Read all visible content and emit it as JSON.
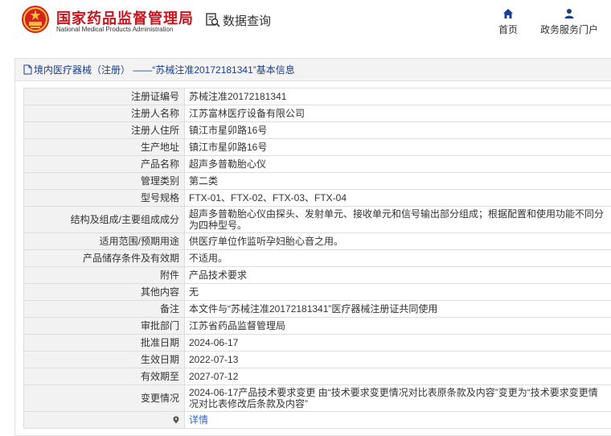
{
  "header": {
    "site_title": "国家药品监督管理局",
    "site_subtitle": "National Medical Products Administration",
    "query_label": "数据查询",
    "nav": [
      {
        "label": "首页",
        "icon": "home-icon"
      },
      {
        "label": "政务服务门户",
        "icon": "user-icon"
      }
    ],
    "brand_color": "#c8161e",
    "nav_icon_color": "#1a3f8f"
  },
  "panel": {
    "title": "境内医疗器械（注册） ——“苏械注准20172181341”基本信息"
  },
  "rows": [
    {
      "label": "注册证编号",
      "value": "苏械注准20172181341"
    },
    {
      "label": "注册人名称",
      "value": "江苏富林医疗设备有限公司"
    },
    {
      "label": "注册人住所",
      "value": "镇江市星卯路16号"
    },
    {
      "label": "生产地址",
      "value": "镇江市星卯路16号"
    },
    {
      "label": "产品名称",
      "value": "超声多普勒胎心仪"
    },
    {
      "label": "管理类别",
      "value": "第二类"
    },
    {
      "label": "型号规格",
      "value": "FTX-01、FTX-02、FTX-03、FTX-04"
    },
    {
      "label": "结构及组成/主要组成成分",
      "value": "超声多普勒胎心仪由探头、发射单元、接收单元和信号输出部分组成；根据配置和使用功能不同分为四种型号。"
    },
    {
      "label": "适用范围/预期用途",
      "value": "供医疗单位作监听孕妇胎心音之用。"
    },
    {
      "label": "产品储存条件及有效期",
      "value": "不适用。"
    },
    {
      "label": "附件",
      "value": "产品技术要求"
    },
    {
      "label": "其他内容",
      "value": "无"
    },
    {
      "label": "备注",
      "value": "本文件与“苏械注准20172181341”医疗器械注册证共同使用"
    },
    {
      "label": "审批部门",
      "value": "江苏省药品监督管理局"
    },
    {
      "label": "批准日期",
      "value": "2024-06-17"
    },
    {
      "label": "生效日期",
      "value": "2022-07-13"
    },
    {
      "label": "有效期至",
      "value": "2027-07-12"
    },
    {
      "label": "变更情况",
      "value": "2024-06-17产品技术要求变更 由“技术要求变更情况对比表原条款及内容”变更为“技术要求变更情况对比表修改后条款及内容”"
    }
  ],
  "footer_row": {
    "pin_icon": "location-pin-icon",
    "link_label": "详情"
  }
}
